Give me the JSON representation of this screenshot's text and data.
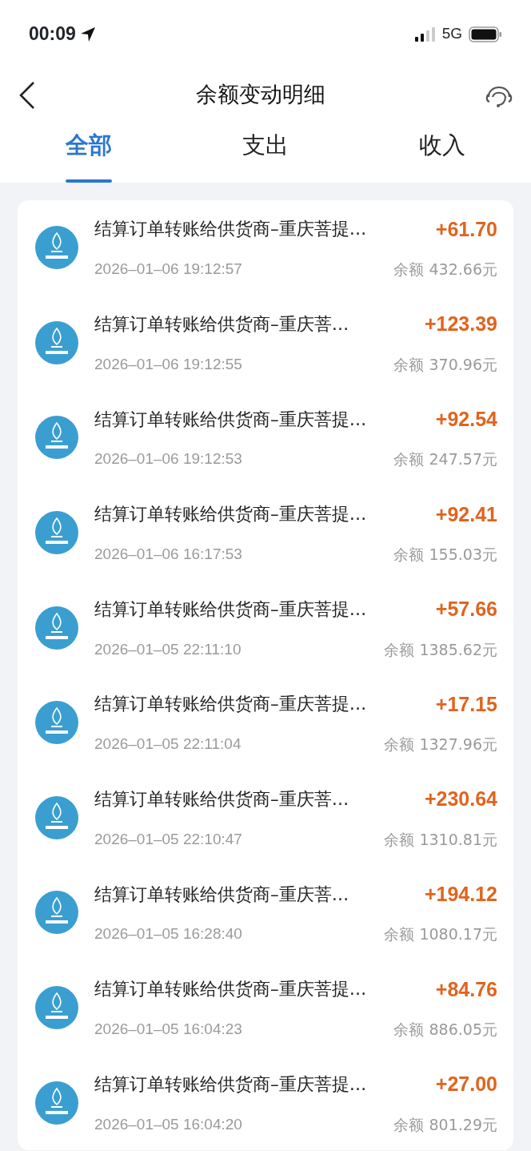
{
  "status_bar": {
    "time": "00:09",
    "network": "5G"
  },
  "header": {
    "title": "余额变动明细"
  },
  "tabs": [
    {
      "label": "全部",
      "selected": true
    },
    {
      "label": "支出",
      "selected": false
    },
    {
      "label": "收入",
      "selected": false
    }
  ],
  "records": [
    {
      "title": "结算订单转账给供货商–重庆菩提…",
      "amount": "+61.70",
      "time": "2026–01–06 19:12:57",
      "balance": "余额 432.66元"
    },
    {
      "title": "结算订单转账给供货商–重庆菩…",
      "amount": "+123.39",
      "time": "2026–01–06 19:12:55",
      "balance": "余额 370.96元"
    },
    {
      "title": "结算订单转账给供货商–重庆菩提…",
      "amount": "+92.54",
      "time": "2026–01–06 19:12:53",
      "balance": "余额 247.57元"
    },
    {
      "title": "结算订单转账给供货商–重庆菩提…",
      "amount": "+92.41",
      "time": "2026–01–06 16:17:53",
      "balance": "余额 155.03元"
    },
    {
      "title": "结算订单转账给供货商–重庆菩提…",
      "amount": "+57.66",
      "time": "2026–01–05 22:11:10",
      "balance": "余额 1385.62元"
    },
    {
      "title": "结算订单转账给供货商–重庆菩提…",
      "amount": "+17.15",
      "time": "2026–01–05 22:11:04",
      "balance": "余额 1327.96元"
    },
    {
      "title": "结算订单转账给供货商–重庆菩…",
      "amount": "+230.64",
      "time": "2026–01–05 22:10:47",
      "balance": "余额 1310.81元"
    },
    {
      "title": "结算订单转账给供货商–重庆菩…",
      "amount": "+194.12",
      "time": "2026–01–05 16:28:40",
      "balance": "余额 1080.17元"
    },
    {
      "title": "结算订单转账给供货商–重庆菩提…",
      "amount": "+84.76",
      "time": "2026–01–05 16:04:23",
      "balance": "余额 886.05元"
    },
    {
      "title": "结算订单转账给供货商–重庆菩提…",
      "amount": "+27.00",
      "time": "2026–01–05 16:04:20",
      "balance": "余额 801.29元"
    }
  ]
}
